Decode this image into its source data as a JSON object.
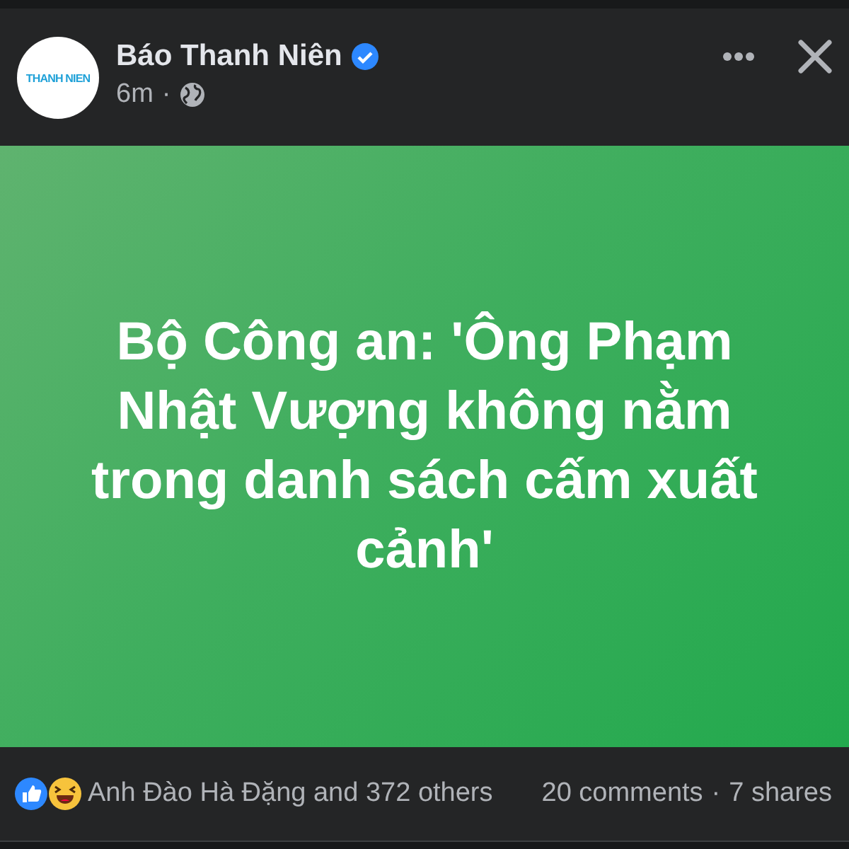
{
  "post": {
    "logo_text": "THANH NIEN",
    "author": "Báo Thanh Niên",
    "verified": true,
    "time": "6m",
    "separator": "·",
    "headline": "Bộ Công an: 'Ông Phạm Nhật Vượng không nằm trong danh sách cấm xuất cảnh'"
  },
  "footer": {
    "reactors": "Anh Đào Hà Đặng and 372 others",
    "comments": "20 comments",
    "separator": "·",
    "shares": "7 shares"
  }
}
